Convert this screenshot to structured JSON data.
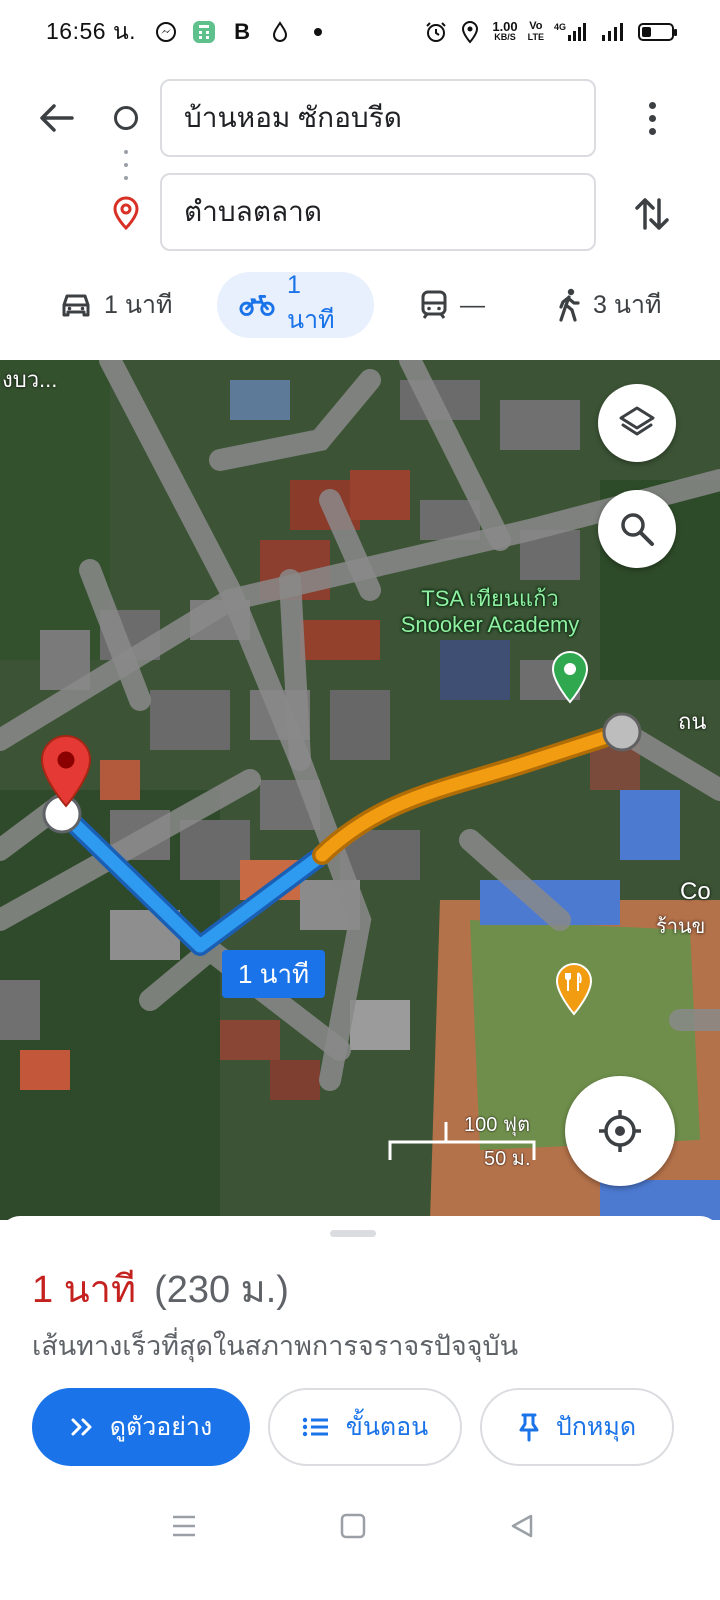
{
  "status_bar": {
    "time": "16:56 น.",
    "app_letter": "B",
    "net_speed_value": "1.00",
    "net_speed_unit": "KB/S",
    "volte_top": "Vo",
    "volte_bottom": "LTE",
    "network": "4G"
  },
  "directions": {
    "origin": "บ้านหอม ซักอบรีด",
    "destination": "ตำบลตลาด"
  },
  "modes": [
    {
      "name": "car",
      "label": "1 นาที",
      "icon": "car-icon"
    },
    {
      "name": "motorcycle",
      "label": "1 นาที",
      "icon": "motorcycle-icon",
      "active": true
    },
    {
      "name": "transit",
      "label": "—",
      "icon": "train-icon"
    },
    {
      "name": "walk",
      "label": "3 นาที",
      "icon": "walk-icon"
    }
  ],
  "map": {
    "poi_name_line1": "TSA เทียนแก้ว",
    "poi_name_line2": "Snooker Academy",
    "top_left_label": "งบว...",
    "right_label_1": "ถน",
    "right_label_2": "Co",
    "right_label_3": "ร้านข",
    "route_duration": "1 นาที",
    "scale_imperial": "100 ฟุต",
    "scale_metric": "50 ม."
  },
  "summary": {
    "time": "1 นาที",
    "distance": "(230 ม.)",
    "description": "เส้นทางเร็วที่สุดในสภาพการจราจรปัจจุบัน"
  },
  "actions": {
    "preview": "ดูตัวอย่าง",
    "steps": "ขั้นตอน",
    "pin": "ปักหมุด"
  },
  "colors": {
    "accent": "#1a73e8",
    "route_blue": "#2e9bf0",
    "route_orange": "#f29c12",
    "time_red": "#c5221f",
    "poi_green": "#2fa84f"
  }
}
